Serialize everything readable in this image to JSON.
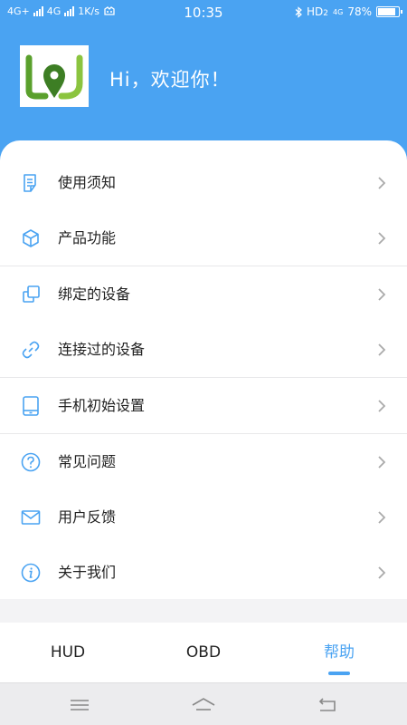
{
  "status_bar": {
    "network_1": "4G+",
    "network_2": "4G",
    "speed": "1K/s",
    "time": "10:35",
    "hd": "HD",
    "hd_sub": "2",
    "network_3": "4G",
    "battery_text": "78%",
    "battery_level": 0.78
  },
  "header": {
    "greeting": "Hi，欢迎你！",
    "background_color": "#4aa3f2"
  },
  "menu": {
    "items": [
      {
        "label": "使用须知",
        "icon": "document-icon"
      },
      {
        "label": "产品功能",
        "icon": "cube-icon"
      },
      {
        "label": "绑定的设备",
        "icon": "copy-icon"
      },
      {
        "label": "连接过的设备",
        "icon": "link-icon"
      },
      {
        "label": "手机初始设置",
        "icon": "tablet-icon"
      },
      {
        "label": "常见问题",
        "icon": "question-icon"
      },
      {
        "label": "用户反馈",
        "icon": "mail-icon"
      },
      {
        "label": "关于我们",
        "icon": "info-icon"
      }
    ]
  },
  "tabbar": {
    "tabs": [
      {
        "label": "HUD"
      },
      {
        "label": "OBD"
      },
      {
        "label": "帮助",
        "active": true
      }
    ]
  },
  "navbar": {
    "buttons": [
      "menu-icon",
      "home-icon",
      "back-icon"
    ]
  }
}
